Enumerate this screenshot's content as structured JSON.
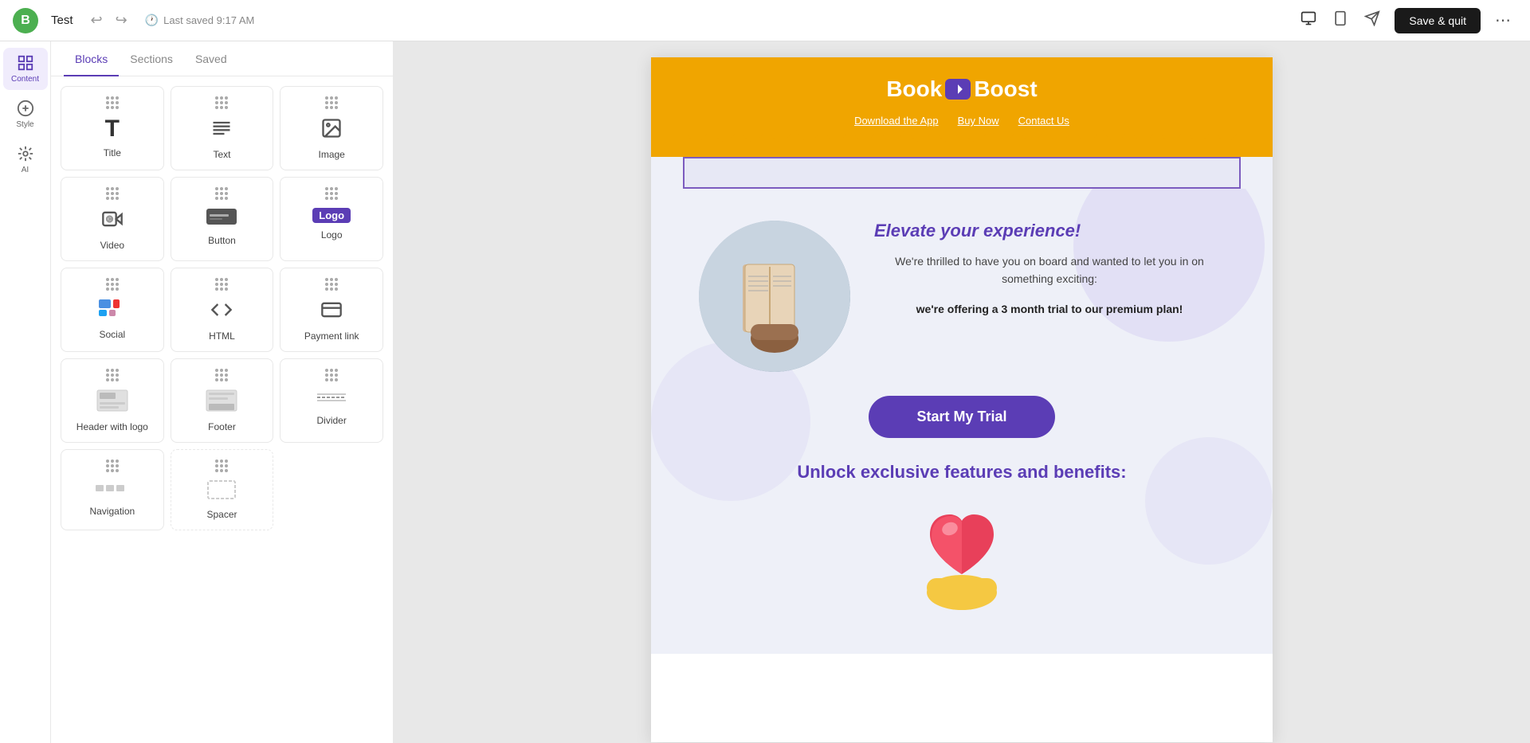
{
  "topbar": {
    "brand_letter": "B",
    "title": "Test",
    "undo_label": "↩",
    "redo_label": "↪",
    "last_saved": "Last saved 9:17 AM",
    "save_quit_label": "Save & quit",
    "more_label": "⋯"
  },
  "sidebar": {
    "items": [
      {
        "id": "content",
        "label": "Content",
        "icon": "grid"
      },
      {
        "id": "style",
        "label": "Style",
        "icon": "brush"
      },
      {
        "id": "ai",
        "label": "AI",
        "icon": "ai"
      }
    ]
  },
  "blocks_panel": {
    "tabs": [
      {
        "id": "blocks",
        "label": "Blocks"
      },
      {
        "id": "sections",
        "label": "Sections"
      },
      {
        "id": "saved",
        "label": "Saved"
      }
    ],
    "blocks": [
      {
        "id": "title",
        "label": "Title",
        "icon": "T_large"
      },
      {
        "id": "text",
        "label": "Text",
        "icon": "T_lines"
      },
      {
        "id": "image",
        "label": "Image",
        "icon": "image"
      },
      {
        "id": "video",
        "label": "Video",
        "icon": "video"
      },
      {
        "id": "button",
        "label": "Button",
        "icon": "button"
      },
      {
        "id": "logo",
        "label": "Logo",
        "icon": "logo"
      },
      {
        "id": "social",
        "label": "Social",
        "icon": "social"
      },
      {
        "id": "html",
        "label": "HTML",
        "icon": "html"
      },
      {
        "id": "payment_link",
        "label": "Payment link",
        "icon": "payment"
      },
      {
        "id": "header_with_logo",
        "label": "Header with logo",
        "icon": "header"
      },
      {
        "id": "footer",
        "label": "Footer",
        "icon": "footer"
      },
      {
        "id": "divider",
        "label": "Divider",
        "icon": "divider"
      },
      {
        "id": "navigation",
        "label": "Navigation",
        "icon": "navigation"
      },
      {
        "id": "spacer",
        "label": "Spacer",
        "icon": "spacer"
      }
    ]
  },
  "email": {
    "brand_book": "Book",
    "brand_boost": "Boost",
    "nav_links": [
      {
        "label": "Download the App"
      },
      {
        "label": "Buy Now"
      },
      {
        "label": "Contact Us"
      }
    ],
    "headline": "Elevate your experience!",
    "body_text": "We're thrilled to have you on board and wanted to let you in on something exciting:",
    "offer_text": "we're offering a 3 month trial to our premium plan!",
    "cta_label": "Start My Trial",
    "features_title": "Unlock exclusive features and benefits:"
  }
}
